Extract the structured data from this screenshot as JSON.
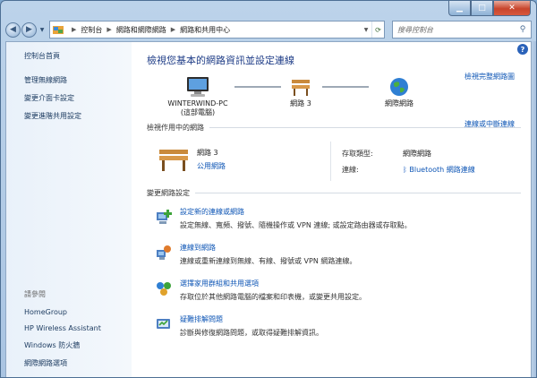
{
  "address": {
    "crumbs": [
      "控制台",
      "網路和網際網路",
      "網路和共用中心"
    ]
  },
  "search": {
    "placeholder": "搜尋控制台"
  },
  "sidebar": {
    "title": "控制台首頁",
    "links": [
      "管理無線網路",
      "變更介面卡設定",
      "變更進階共用設定"
    ],
    "see_also_title": "請參閱",
    "see_also": [
      "HomeGroup",
      "HP Wireless Assistant",
      "Windows 防火牆",
      "網際網路選項"
    ]
  },
  "main": {
    "title": "檢視您基本的網路資訊並設定連線",
    "full_map_link": "檢視完整網路圖",
    "map": {
      "computer_name": "WINTERWIND-PC",
      "computer_sub": "(這部電腦)",
      "network": "網路 3",
      "internet": "網際網路"
    },
    "active_section": {
      "title": "檢視作用中的網路",
      "link": "連線或中斷連線",
      "network_name": "網路 3",
      "network_type": "公用網路",
      "access_type_label": "存取類型:",
      "access_type_value": "網際網路",
      "connection_label": "連線:",
      "connection_value": "Bluetooth 網路連線"
    },
    "change_section": {
      "title": "變更網路設定",
      "tasks": [
        {
          "title": "設定新的連線或網路",
          "desc": "設定無線、寬頻、撥號、隨機操作或 VPN 連線; 或設定路由器或存取點。"
        },
        {
          "title": "連線到網路",
          "desc": "連線或重新連線到無線、有線、撥號或 VPN 網路連線。"
        },
        {
          "title": "選擇家用群組和共用選項",
          "desc": "存取位於其他網路電腦的檔案和印表機，或變更共用設定。"
        },
        {
          "title": "疑難排解問題",
          "desc": "診斷與修復網路問題，或取得疑難排解資訊。"
        }
      ]
    }
  },
  "colors": {
    "link": "#0d55b5",
    "title": "#1f3d87",
    "sidebar_bg": "#e9f1fa"
  }
}
